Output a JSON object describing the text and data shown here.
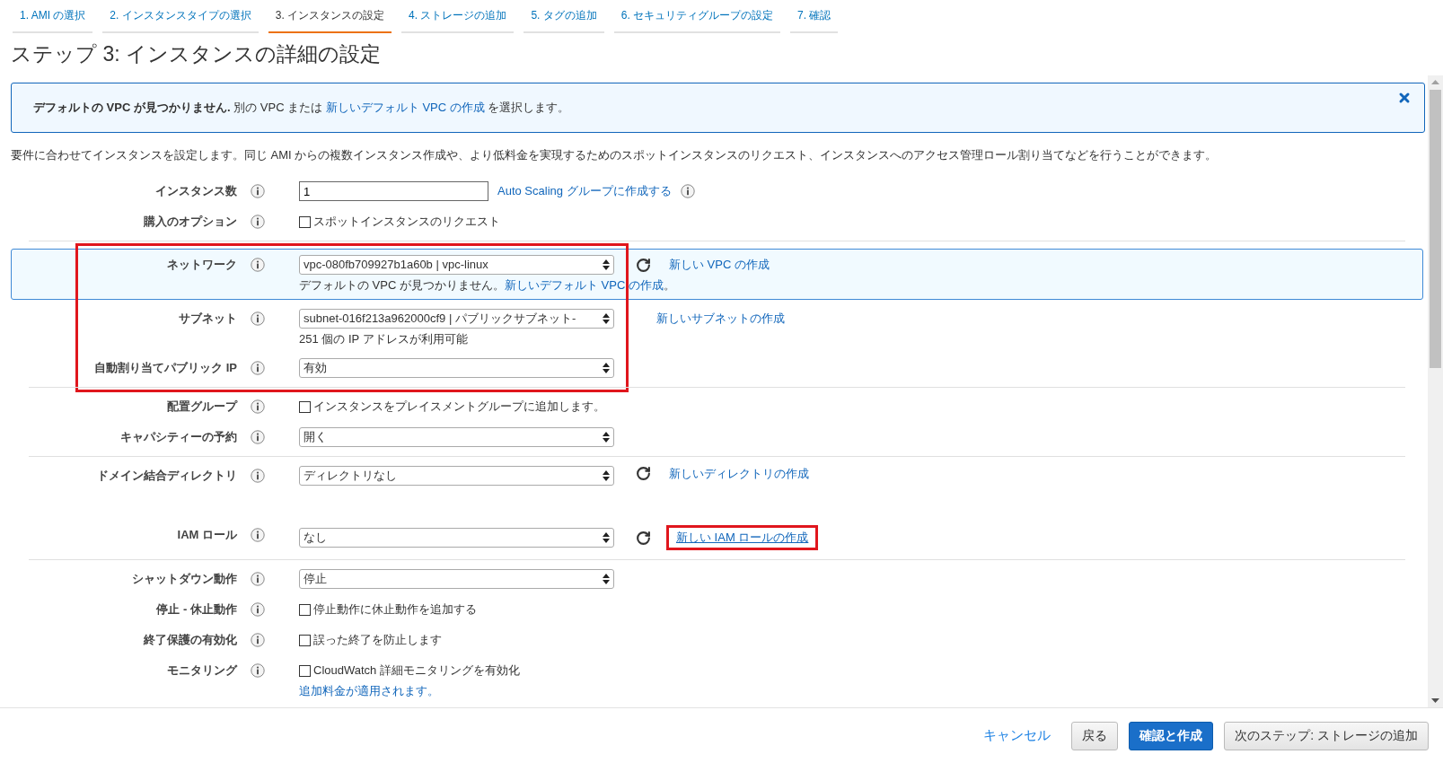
{
  "tabs": [
    {
      "label": "1. AMI の選択",
      "selected": false
    },
    {
      "label": "2. インスタンスタイプの選択",
      "selected": false
    },
    {
      "label": "3. インスタンスの設定",
      "selected": true
    },
    {
      "label": "4. ストレージの追加",
      "selected": false
    },
    {
      "label": "5. タグの追加",
      "selected": false
    },
    {
      "label": "6. セキュリティグループの設定",
      "selected": false
    },
    {
      "label": "7. 確認",
      "selected": false
    }
  ],
  "title": "ステップ 3: インスタンスの詳細の設定",
  "alert": {
    "text": "**デフォルトの VPC が見つかりません.** 別の VPC または ",
    "link": "新しいデフォルト VPC の作成",
    "text_after": " を選択します。"
  },
  "description": "要件に合わせてインスタンスを設定します。同じ AMI からの複数インスタンス作成や、より低料金を実現するためのスポットインスタンスのリクエスト、インスタンスへのアクセス管理ロール割り当てなどを行うことができます。",
  "sections": [
    {
      "annotated": false,
      "rows": [
        {
          "label": "インスタンス数",
          "kind": "input",
          "value": "1",
          "link": "Auto Scaling グループに作成する",
          "link_info": true
        },
        {
          "label": "購入のオプション",
          "kind": "checkbox",
          "checked": false,
          "option": "スポットインスタンスのリクエスト"
        }
      ]
    },
    {
      "annotated": true,
      "rows": [
        {
          "label": "ネットワーク",
          "kind": "select",
          "value": "vpc-080fb709927b1a60b | vpc-linux",
          "refresh": true,
          "link": "新しい VPC の作成",
          "highlighted": true,
          "note": "デフォルトの VPC が見つかりません。",
          "note_link": "新しいデフォルト VPC の作成",
          "note_after": "。"
        },
        {
          "label": "サブネット",
          "kind": "select",
          "value": "subnet-016f213a962000cf9 | パブリックサブネット-",
          "refresh": false,
          "link": "新しいサブネットの作成",
          "note": "251 個の IP アドレスが利用可能"
        },
        {
          "label": "自動割り当てパブリック IP",
          "kind": "select",
          "value": "有効"
        }
      ]
    },
    {
      "annotated": false,
      "rows": [
        {
          "label": "配置グループ",
          "kind": "checkbox",
          "checked": false,
          "option": "インスタンスをプレイスメントグループに追加します。"
        },
        {
          "label": "キャパシティーの予約",
          "kind": "select",
          "value": "開く"
        }
      ]
    },
    {
      "annotated": false,
      "rows": [
        {
          "label": "ドメイン結合ディレクトリ",
          "kind": "select",
          "value": "ディレクトリなし",
          "refresh": true,
          "link": "新しいディレクトリの作成"
        },
        {
          "label": "IAM ロール",
          "kind": "select",
          "value": "なし",
          "refresh": true,
          "link": "新しい IAM ロールの作成",
          "link_annotated": true
        }
      ]
    },
    {
      "annotated": false,
      "rows": [
        {
          "label": "シャットダウン動作",
          "kind": "select",
          "value": "停止"
        },
        {
          "label": "停止 - 休止動作",
          "kind": "checkbox",
          "checked": false,
          "option": "停止動作に休止動作を追加する"
        },
        {
          "label": "終了保護の有効化",
          "kind": "checkbox",
          "checked": false,
          "option": "誤った終了を防止します"
        },
        {
          "label": "モニタリング",
          "kind": "checkbox",
          "checked": false,
          "option": "CloudWatch 詳細モニタリングを有効化",
          "note_link": "追加料金が適用されます。"
        }
      ]
    }
  ],
  "footer": [
    {
      "label": "キャンセル",
      "kind": "link"
    },
    {
      "label": "戻る",
      "kind": "default"
    },
    {
      "label": "確認と作成",
      "kind": "primary"
    },
    {
      "label": "次のステップ: ストレージの追加",
      "kind": "default"
    }
  ]
}
